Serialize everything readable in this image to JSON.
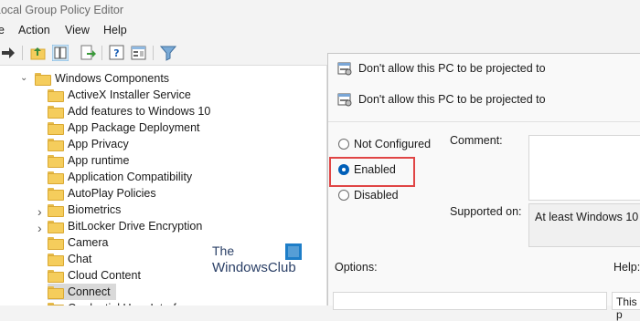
{
  "window": {
    "title": "Local Group Policy Editor"
  },
  "menu": {
    "items": [
      "File",
      "Action",
      "View",
      "Help"
    ],
    "visible": [
      "e",
      "Action",
      "View",
      "Help"
    ]
  },
  "tree": {
    "parent": "Windows Components",
    "items": [
      "ActiveX Installer Service",
      "Add features to Windows 10",
      "App Package Deployment",
      "App Privacy",
      "App runtime",
      "Application Compatibility",
      "AutoPlay Policies",
      "Biometrics",
      "BitLocker Drive Encryption",
      "Camera",
      "Chat",
      "Cloud Content",
      "Connect",
      "Credential User Interface"
    ],
    "selected": "Connect"
  },
  "dialog": {
    "title": "Don't allow this PC to be projected to",
    "policy_name": "Don't allow this PC to be projected to",
    "options": {
      "not_configured": "Not Configured",
      "enabled": "Enabled",
      "disabled": "Disabled"
    },
    "selected_option": "Enabled",
    "comment_label": "Comment:",
    "supported_label": "Supported on:",
    "supported_value": "At least Windows 10",
    "options_label": "Options:",
    "help_label": "Help:",
    "help_text": "This p"
  },
  "watermark": {
    "line1": "The",
    "line2": "WindowsClub"
  },
  "colors": {
    "accent": "#005fb8",
    "highlight": "#e04545",
    "folder": "#f5cd5c",
    "selected_row": "#d9d9d9"
  }
}
